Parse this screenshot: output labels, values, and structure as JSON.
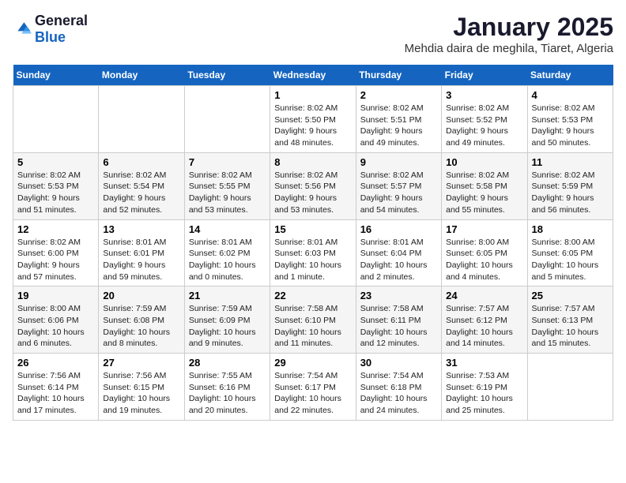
{
  "header": {
    "logo_general": "General",
    "logo_blue": "Blue",
    "month_year": "January 2025",
    "location": "Mehdia daira de meghila, Tiaret, Algeria"
  },
  "weekdays": [
    "Sunday",
    "Monday",
    "Tuesday",
    "Wednesday",
    "Thursday",
    "Friday",
    "Saturday"
  ],
  "weeks": [
    [
      {
        "day": "",
        "info": ""
      },
      {
        "day": "",
        "info": ""
      },
      {
        "day": "",
        "info": ""
      },
      {
        "day": "1",
        "info": "Sunrise: 8:02 AM\nSunset: 5:50 PM\nDaylight: 9 hours\nand 48 minutes."
      },
      {
        "day": "2",
        "info": "Sunrise: 8:02 AM\nSunset: 5:51 PM\nDaylight: 9 hours\nand 49 minutes."
      },
      {
        "day": "3",
        "info": "Sunrise: 8:02 AM\nSunset: 5:52 PM\nDaylight: 9 hours\nand 49 minutes."
      },
      {
        "day": "4",
        "info": "Sunrise: 8:02 AM\nSunset: 5:53 PM\nDaylight: 9 hours\nand 50 minutes."
      }
    ],
    [
      {
        "day": "5",
        "info": "Sunrise: 8:02 AM\nSunset: 5:53 PM\nDaylight: 9 hours\nand 51 minutes."
      },
      {
        "day": "6",
        "info": "Sunrise: 8:02 AM\nSunset: 5:54 PM\nDaylight: 9 hours\nand 52 minutes."
      },
      {
        "day": "7",
        "info": "Sunrise: 8:02 AM\nSunset: 5:55 PM\nDaylight: 9 hours\nand 53 minutes."
      },
      {
        "day": "8",
        "info": "Sunrise: 8:02 AM\nSunset: 5:56 PM\nDaylight: 9 hours\nand 53 minutes."
      },
      {
        "day": "9",
        "info": "Sunrise: 8:02 AM\nSunset: 5:57 PM\nDaylight: 9 hours\nand 54 minutes."
      },
      {
        "day": "10",
        "info": "Sunrise: 8:02 AM\nSunset: 5:58 PM\nDaylight: 9 hours\nand 55 minutes."
      },
      {
        "day": "11",
        "info": "Sunrise: 8:02 AM\nSunset: 5:59 PM\nDaylight: 9 hours\nand 56 minutes."
      }
    ],
    [
      {
        "day": "12",
        "info": "Sunrise: 8:02 AM\nSunset: 6:00 PM\nDaylight: 9 hours\nand 57 minutes."
      },
      {
        "day": "13",
        "info": "Sunrise: 8:01 AM\nSunset: 6:01 PM\nDaylight: 9 hours\nand 59 minutes."
      },
      {
        "day": "14",
        "info": "Sunrise: 8:01 AM\nSunset: 6:02 PM\nDaylight: 10 hours\nand 0 minutes."
      },
      {
        "day": "15",
        "info": "Sunrise: 8:01 AM\nSunset: 6:03 PM\nDaylight: 10 hours\nand 1 minute."
      },
      {
        "day": "16",
        "info": "Sunrise: 8:01 AM\nSunset: 6:04 PM\nDaylight: 10 hours\nand 2 minutes."
      },
      {
        "day": "17",
        "info": "Sunrise: 8:00 AM\nSunset: 6:05 PM\nDaylight: 10 hours\nand 4 minutes."
      },
      {
        "day": "18",
        "info": "Sunrise: 8:00 AM\nSunset: 6:05 PM\nDaylight: 10 hours\nand 5 minutes."
      }
    ],
    [
      {
        "day": "19",
        "info": "Sunrise: 8:00 AM\nSunset: 6:06 PM\nDaylight: 10 hours\nand 6 minutes."
      },
      {
        "day": "20",
        "info": "Sunrise: 7:59 AM\nSunset: 6:08 PM\nDaylight: 10 hours\nand 8 minutes."
      },
      {
        "day": "21",
        "info": "Sunrise: 7:59 AM\nSunset: 6:09 PM\nDaylight: 10 hours\nand 9 minutes."
      },
      {
        "day": "22",
        "info": "Sunrise: 7:58 AM\nSunset: 6:10 PM\nDaylight: 10 hours\nand 11 minutes."
      },
      {
        "day": "23",
        "info": "Sunrise: 7:58 AM\nSunset: 6:11 PM\nDaylight: 10 hours\nand 12 minutes."
      },
      {
        "day": "24",
        "info": "Sunrise: 7:57 AM\nSunset: 6:12 PM\nDaylight: 10 hours\nand 14 minutes."
      },
      {
        "day": "25",
        "info": "Sunrise: 7:57 AM\nSunset: 6:13 PM\nDaylight: 10 hours\nand 15 minutes."
      }
    ],
    [
      {
        "day": "26",
        "info": "Sunrise: 7:56 AM\nSunset: 6:14 PM\nDaylight: 10 hours\nand 17 minutes."
      },
      {
        "day": "27",
        "info": "Sunrise: 7:56 AM\nSunset: 6:15 PM\nDaylight: 10 hours\nand 19 minutes."
      },
      {
        "day": "28",
        "info": "Sunrise: 7:55 AM\nSunset: 6:16 PM\nDaylight: 10 hours\nand 20 minutes."
      },
      {
        "day": "29",
        "info": "Sunrise: 7:54 AM\nSunset: 6:17 PM\nDaylight: 10 hours\nand 22 minutes."
      },
      {
        "day": "30",
        "info": "Sunrise: 7:54 AM\nSunset: 6:18 PM\nDaylight: 10 hours\nand 24 minutes."
      },
      {
        "day": "31",
        "info": "Sunrise: 7:53 AM\nSunset: 6:19 PM\nDaylight: 10 hours\nand 25 minutes."
      },
      {
        "day": "",
        "info": ""
      }
    ]
  ]
}
